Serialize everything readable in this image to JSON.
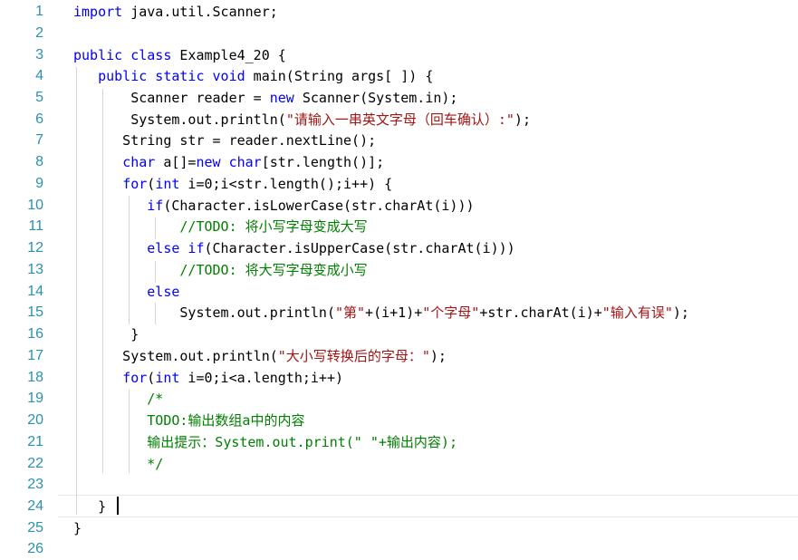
{
  "editor": {
    "current_line": "24",
    "lines": [
      {
        "n": "1",
        "tokens": [
          {
            "t": "import",
            "c": "kw"
          },
          {
            "t": " java.util.Scanner;"
          }
        ]
      },
      {
        "n": "2",
        "tokens": []
      },
      {
        "n": "3",
        "tokens": [
          {
            "t": "public class",
            "c": "kw"
          },
          {
            "t": " Example4_20 {"
          }
        ]
      },
      {
        "n": "4",
        "tokens": [
          {
            "t": "   "
          },
          {
            "t": "public static void",
            "c": "kw"
          },
          {
            "t": " main(String args[ ]) {"
          }
        ]
      },
      {
        "n": "5",
        "tokens": [
          {
            "t": "       Scanner reader = "
          },
          {
            "t": "new",
            "c": "kw"
          },
          {
            "t": " Scanner(System.in);"
          }
        ]
      },
      {
        "n": "6",
        "tokens": [
          {
            "t": "       System.out.println("
          },
          {
            "t": "\"请输入一串英文字母（回车确认）:\"",
            "c": "str"
          },
          {
            "t": ");"
          }
        ]
      },
      {
        "n": "7",
        "tokens": [
          {
            "t": "      String str = reader.nextLine();"
          }
        ]
      },
      {
        "n": "8",
        "tokens": [
          {
            "t": "      "
          },
          {
            "t": "char",
            "c": "kw"
          },
          {
            "t": " a[]="
          },
          {
            "t": "new",
            "c": "kw"
          },
          {
            "t": " "
          },
          {
            "t": "char",
            "c": "kw"
          },
          {
            "t": "[str.length()];"
          }
        ]
      },
      {
        "n": "9",
        "tokens": [
          {
            "t": "      "
          },
          {
            "t": "for",
            "c": "kw"
          },
          {
            "t": "("
          },
          {
            "t": "int",
            "c": "kw"
          },
          {
            "t": " i="
          },
          {
            "t": "0",
            "c": "num"
          },
          {
            "t": ";i<str.length();i++) {"
          }
        ]
      },
      {
        "n": "10",
        "tokens": [
          {
            "t": "         "
          },
          {
            "t": "if",
            "c": "kw"
          },
          {
            "t": "(Character.isLowerCase(str.charAt(i)))"
          }
        ]
      },
      {
        "n": "11",
        "tokens": [
          {
            "t": "             "
          },
          {
            "t": "//TODO: 将小写字母变成大写",
            "c": "cm"
          }
        ]
      },
      {
        "n": "12",
        "tokens": [
          {
            "t": "         "
          },
          {
            "t": "else if",
            "c": "kw"
          },
          {
            "t": "(Character.isUpperCase(str.charAt(i)))"
          }
        ]
      },
      {
        "n": "13",
        "tokens": [
          {
            "t": "             "
          },
          {
            "t": "//TODO: 将大写字母变成小写",
            "c": "cm"
          }
        ]
      },
      {
        "n": "14",
        "tokens": [
          {
            "t": "         "
          },
          {
            "t": "else",
            "c": "kw"
          }
        ]
      },
      {
        "n": "15",
        "tokens": [
          {
            "t": "             System.out.println("
          },
          {
            "t": "\"第\"",
            "c": "str"
          },
          {
            "t": "+(i+"
          },
          {
            "t": "1",
            "c": "num"
          },
          {
            "t": ")+"
          },
          {
            "t": "\"个字母\"",
            "c": "str"
          },
          {
            "t": "+str.charAt(i)+"
          },
          {
            "t": "\"输入有误\"",
            "c": "str"
          },
          {
            "t": ");"
          }
        ]
      },
      {
        "n": "16",
        "tokens": [
          {
            "t": "       }"
          }
        ]
      },
      {
        "n": "17",
        "tokens": [
          {
            "t": "      System.out.println("
          },
          {
            "t": "\"大小写转换后的字母：\"",
            "c": "str"
          },
          {
            "t": ");"
          }
        ]
      },
      {
        "n": "18",
        "tokens": [
          {
            "t": "      "
          },
          {
            "t": "for",
            "c": "kw"
          },
          {
            "t": "("
          },
          {
            "t": "int",
            "c": "kw"
          },
          {
            "t": " i="
          },
          {
            "t": "0",
            "c": "num"
          },
          {
            "t": ";i<a.length;i++)"
          }
        ]
      },
      {
        "n": "19",
        "tokens": [
          {
            "t": "         "
          },
          {
            "t": "/*",
            "c": "cm"
          }
        ]
      },
      {
        "n": "20",
        "tokens": [
          {
            "t": "         "
          },
          {
            "t": "TODO:输出数组a中的内容",
            "c": "cm"
          }
        ]
      },
      {
        "n": "21",
        "tokens": [
          {
            "t": "         "
          },
          {
            "t": "输出提示：System.out.print(\" \"+输出内容);",
            "c": "cm"
          }
        ]
      },
      {
        "n": "22",
        "tokens": [
          {
            "t": "         "
          },
          {
            "t": "*/",
            "c": "cm"
          }
        ]
      },
      {
        "n": "23",
        "tokens": []
      },
      {
        "n": "24",
        "tokens": [
          {
            "t": "   } "
          }
        ]
      },
      {
        "n": "25",
        "tokens": [
          {
            "t": "}"
          }
        ]
      },
      {
        "n": "26",
        "tokens": []
      }
    ],
    "colors": {
      "keyword": "#0000ff",
      "string": "#a31515",
      "comment": "#008000",
      "number": "#000000",
      "line_number": "#2b91af",
      "text": "#000000"
    }
  }
}
